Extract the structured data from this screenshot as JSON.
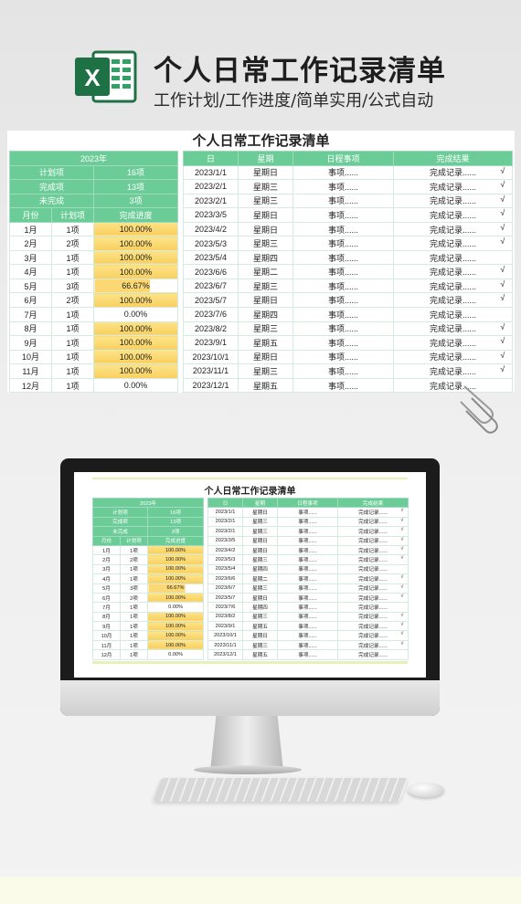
{
  "header": {
    "logo_letter": "X",
    "title": "个人日常工作记录清单",
    "subtitle": "工作计划/工作进度/简单实用/公式自动"
  },
  "sheet": {
    "title": "个人日常工作记录清单",
    "year": "2023年",
    "stats": [
      {
        "label": "计划项",
        "value": "16项"
      },
      {
        "label": "完成项",
        "value": "13项"
      },
      {
        "label": "未完成",
        "value": "3项"
      }
    ],
    "month_headers": [
      "月份",
      "计划项",
      "完成进度"
    ],
    "months": [
      {
        "month": "1月",
        "plan": "1项",
        "progress": "100.00%",
        "level": 1
      },
      {
        "month": "2月",
        "plan": "2项",
        "progress": "100.00%",
        "level": 1
      },
      {
        "month": "3月",
        "plan": "1项",
        "progress": "100.00%",
        "level": 1
      },
      {
        "month": "4月",
        "plan": "1项",
        "progress": "100.00%",
        "level": 1
      },
      {
        "month": "5月",
        "plan": "3项",
        "progress": "66.67%",
        "level": 0.6667
      },
      {
        "month": "6月",
        "plan": "2项",
        "progress": "100.00%",
        "level": 1
      },
      {
        "month": "7月",
        "plan": "1项",
        "progress": "0.00%",
        "level": 0
      },
      {
        "month": "8月",
        "plan": "1项",
        "progress": "100.00%",
        "level": 1
      },
      {
        "month": "9月",
        "plan": "1项",
        "progress": "100.00%",
        "level": 1
      },
      {
        "month": "10月",
        "plan": "1项",
        "progress": "100.00%",
        "level": 1
      },
      {
        "month": "11月",
        "plan": "1项",
        "progress": "100.00%",
        "level": 1
      },
      {
        "month": "12月",
        "plan": "1项",
        "progress": "0.00%",
        "level": 0
      }
    ],
    "record_headers": [
      "日",
      "星期",
      "日程事项",
      "完成结果"
    ],
    "records": [
      {
        "date": "2023/1/1",
        "weekday": "星期日",
        "item": "事项......",
        "result": "完成记录......",
        "check": "√"
      },
      {
        "date": "2023/2/1",
        "weekday": "星期三",
        "item": "事项......",
        "result": "完成记录......",
        "check": "√"
      },
      {
        "date": "2023/2/1",
        "weekday": "星期三",
        "item": "事项......",
        "result": "完成记录......",
        "check": "√"
      },
      {
        "date": "2023/3/5",
        "weekday": "星期日",
        "item": "事项......",
        "result": "完成记录......",
        "check": "√"
      },
      {
        "date": "2023/4/2",
        "weekday": "星期日",
        "item": "事项......",
        "result": "完成记录......",
        "check": "√"
      },
      {
        "date": "2023/5/3",
        "weekday": "星期三",
        "item": "事项......",
        "result": "完成记录......",
        "check": "√"
      },
      {
        "date": "2023/5/4",
        "weekday": "星期四",
        "item": "事项......",
        "result": "完成记录......",
        "check": ""
      },
      {
        "date": "2023/6/6",
        "weekday": "星期二",
        "item": "事项......",
        "result": "完成记录......",
        "check": "√"
      },
      {
        "date": "2023/6/7",
        "weekday": "星期三",
        "item": "事项......",
        "result": "完成记录......",
        "check": "√"
      },
      {
        "date": "2023/5/7",
        "weekday": "星期日",
        "item": "事项......",
        "result": "完成记录......",
        "check": "√"
      },
      {
        "date": "2023/7/6",
        "weekday": "星期四",
        "item": "事项......",
        "result": "完成记录......",
        "check": ""
      },
      {
        "date": "2023/8/2",
        "weekday": "星期三",
        "item": "事项......",
        "result": "完成记录......",
        "check": "√"
      },
      {
        "date": "2023/9/1",
        "weekday": "星期五",
        "item": "事项......",
        "result": "完成记录......",
        "check": "√"
      },
      {
        "date": "2023/10/1",
        "weekday": "星期日",
        "item": "事项......",
        "result": "完成记录......",
        "check": "√"
      },
      {
        "date": "2023/11/1",
        "weekday": "星期三",
        "item": "事项......",
        "result": "完成记录......",
        "check": "√"
      },
      {
        "date": "2023/12/1",
        "weekday": "星期五",
        "item": "事项......",
        "result": "完成记录......",
        "check": ""
      }
    ]
  },
  "colors": {
    "header_green": "#6ccc98",
    "progress_yellow": "#f9cf5e",
    "excel_green": "#1e7145"
  },
  "icons": {
    "logo": "excel-logo-icon",
    "clips": "paperclip-icon"
  }
}
